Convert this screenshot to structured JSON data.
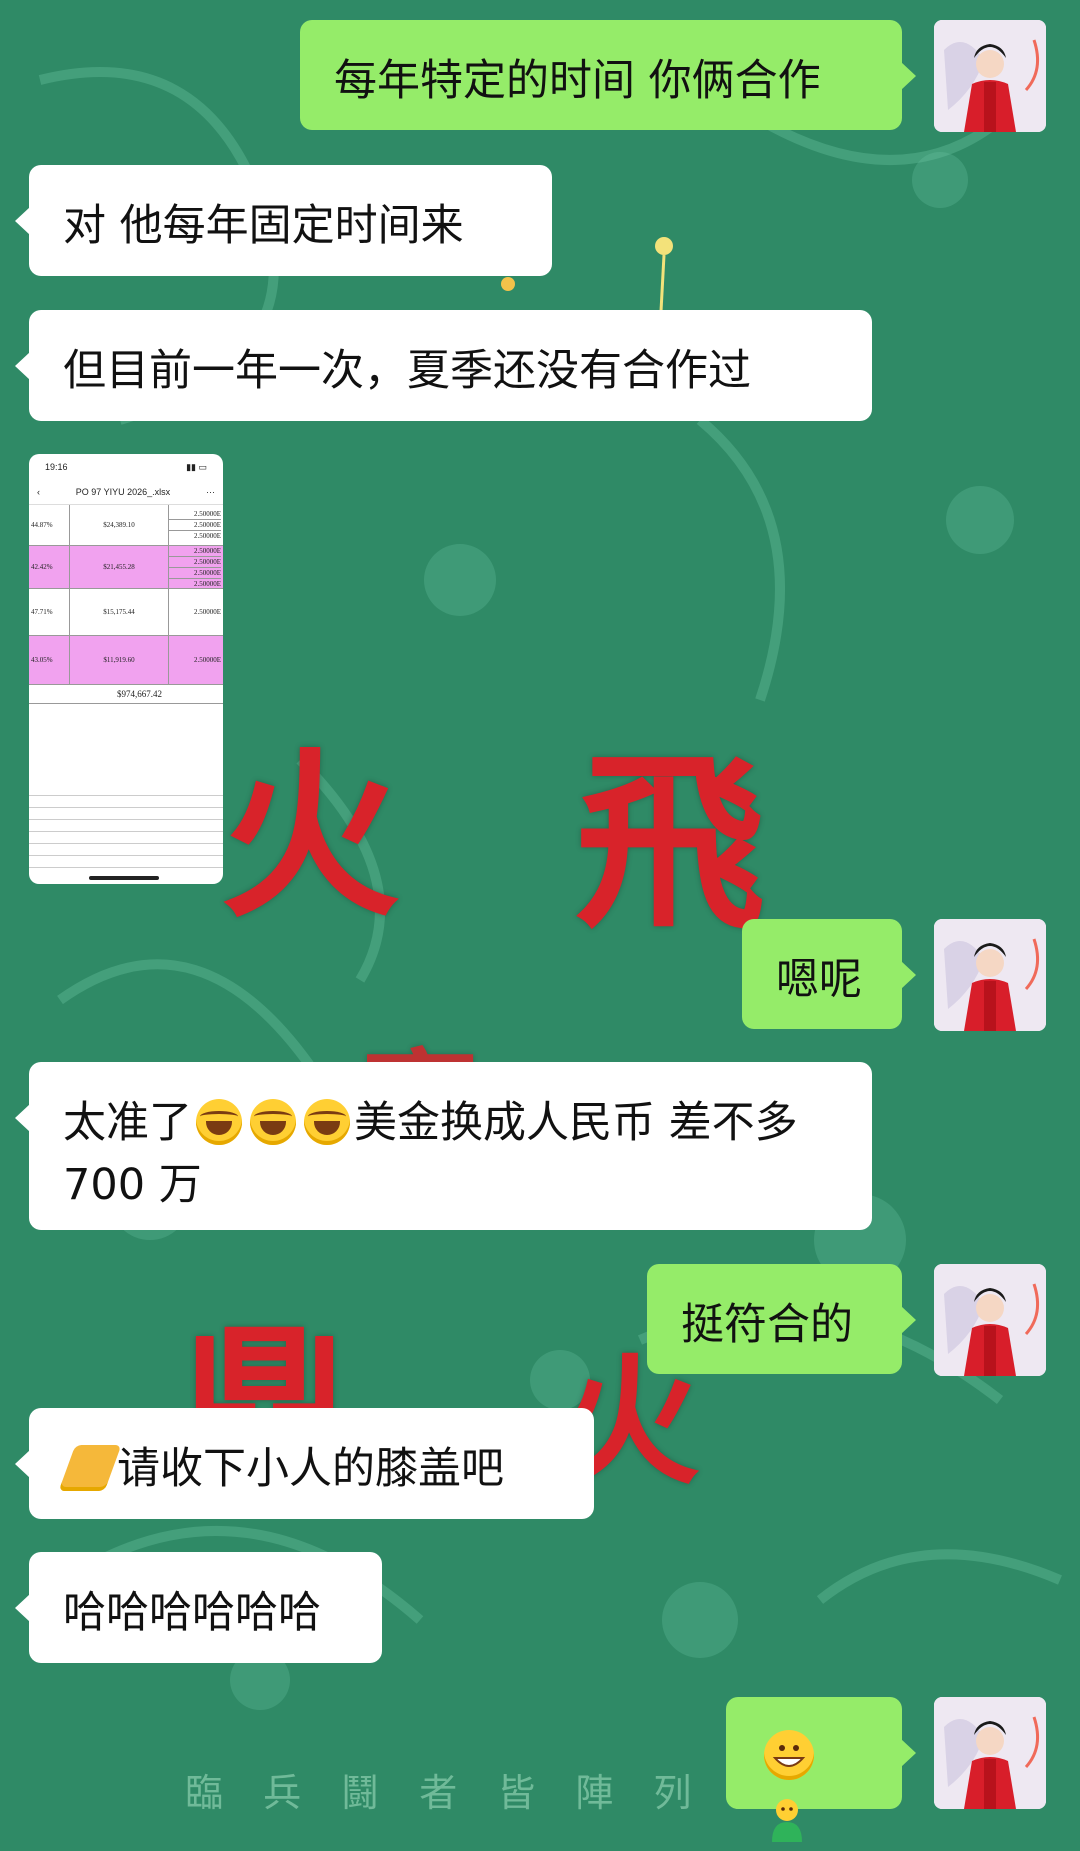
{
  "background": {
    "motto": "臨 兵 鬪 者 皆 陣 列 前",
    "colors": {
      "base": "#2f8a66",
      "red_glyph": "#d8232a"
    }
  },
  "messages": [
    {
      "side": "out",
      "text": "每年特定的时间 你俩合作"
    },
    {
      "side": "in",
      "text": "对 他每年固定时间来"
    },
    {
      "side": "in",
      "text": "但目前一年一次，夏季还没有合作过"
    },
    {
      "side": "in",
      "type": "image"
    },
    {
      "side": "out",
      "text": "嗯呢"
    },
    {
      "side": "in",
      "text_before": "太准了",
      "emoji": [
        "laughing-crying-emoji",
        "laughing-crying-emoji",
        "laughing-crying-emoji"
      ],
      "text_after": "美金换成人民币 差不多",
      "line2": "700 万"
    },
    {
      "side": "out",
      "text": "挺符合的"
    },
    {
      "side": "in",
      "emoji": "pray-emoji",
      "text": "请收下小人的膝盖吧"
    },
    {
      "side": "in",
      "text": "哈哈哈哈哈哈"
    },
    {
      "side": "out",
      "emoji": [
        "grin-emoji",
        "green-figure-emoji"
      ]
    }
  ],
  "thumbnail": {
    "time": "19:16",
    "title": "PO 97 YIYU 2026_.xlsx",
    "rows": [
      {
        "pct": "44.87%",
        "amount": "$24,389.10",
        "vals": [
          "2.50000E",
          "2.50000E",
          "2.50000E"
        ],
        "highlight": false
      },
      {
        "pct": "42.42%",
        "amount": "$21,455.28",
        "vals": [
          "2.50000E",
          "2.50000E",
          "2.50000E",
          "2.50000E"
        ],
        "highlight": true
      },
      {
        "pct": "47.71%",
        "amount": "$15,175.44",
        "vals": [
          "2.50000E"
        ],
        "highlight": false
      },
      {
        "pct": "43.05%",
        "amount": "$11,919.60",
        "vals": [
          "2.50000E"
        ],
        "highlight": true
      }
    ],
    "total": "$974,667.42"
  }
}
